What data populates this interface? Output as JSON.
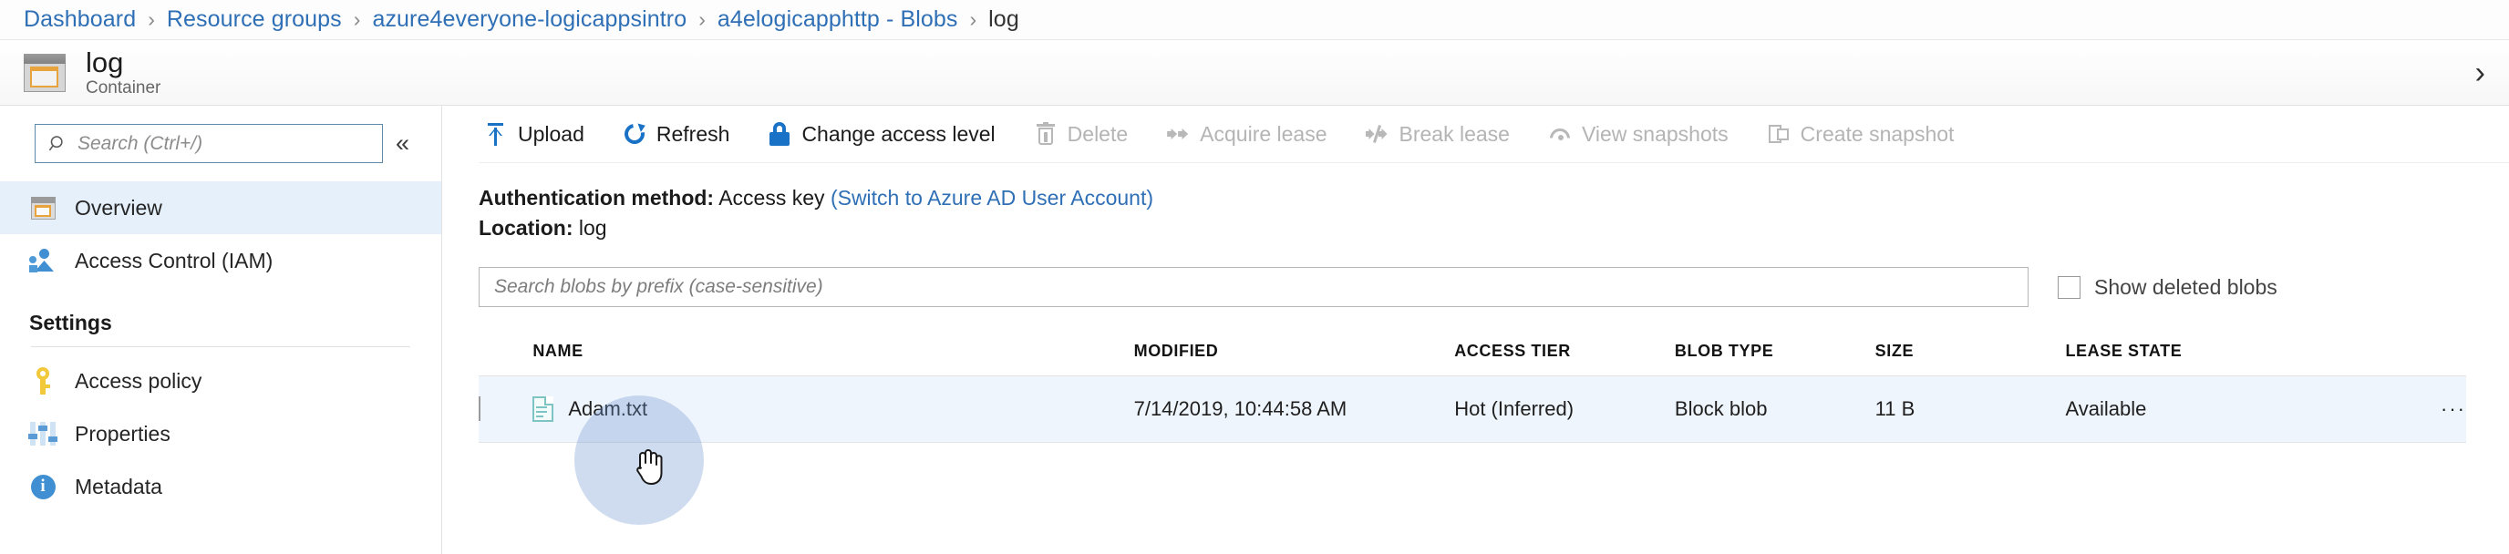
{
  "breadcrumb": {
    "separator": "›",
    "items": [
      {
        "label": "Dashboard",
        "current": false
      },
      {
        "label": "Resource groups",
        "current": false
      },
      {
        "label": "azure4everyone-logicappsintro",
        "current": false
      },
      {
        "label": "a4elogicapphttp - Blobs",
        "current": false
      },
      {
        "label": "log",
        "current": true
      }
    ]
  },
  "header": {
    "title": "log",
    "subtitle": "Container",
    "close_glyph": "›",
    "icon": "container-icon"
  },
  "sidebar": {
    "search": {
      "placeholder": "Search (Ctrl+/)",
      "icon": "search-icon"
    },
    "collapse_glyph": "«",
    "items": [
      {
        "label": "Overview",
        "icon": "container-icon",
        "selected": true
      },
      {
        "label": "Access Control (IAM)",
        "icon": "people-icon",
        "selected": false
      }
    ],
    "settings_section": {
      "title": "Settings",
      "items": [
        {
          "label": "Access policy",
          "icon": "key-icon"
        },
        {
          "label": "Properties",
          "icon": "sliders-icon"
        },
        {
          "label": "Metadata",
          "icon": "info-icon"
        }
      ]
    }
  },
  "toolbar": {
    "buttons": [
      {
        "label": "Upload",
        "icon": "upload-icon",
        "enabled": true
      },
      {
        "label": "Refresh",
        "icon": "refresh-icon",
        "enabled": true
      },
      {
        "label": "Change access level",
        "icon": "lock-icon",
        "enabled": true
      },
      {
        "label": "Delete",
        "icon": "trash-icon",
        "enabled": false
      },
      {
        "label": "Acquire lease",
        "icon": "acquire-lease-icon",
        "enabled": false
      },
      {
        "label": "Break lease",
        "icon": "break-lease-icon",
        "enabled": false
      },
      {
        "label": "View snapshots",
        "icon": "view-snapshots-icon",
        "enabled": false
      },
      {
        "label": "Create snapshot",
        "icon": "create-snapshot-icon",
        "enabled": false
      }
    ]
  },
  "info": {
    "auth_label": "Authentication method:",
    "auth_value": "Access key",
    "auth_switch_link": "(Switch to Azure AD User Account)",
    "location_label": "Location:",
    "location_value": "log"
  },
  "blob_search": {
    "placeholder": "Search blobs by prefix (case-sensitive)",
    "value": ""
  },
  "show_deleted": {
    "label": "Show deleted blobs",
    "checked": false
  },
  "table": {
    "columns": [
      "NAME",
      "MODIFIED",
      "ACCESS TIER",
      "BLOB TYPE",
      "SIZE",
      "LEASE STATE"
    ],
    "rows": [
      {
        "name": "Adam.txt",
        "modified": "7/14/2019, 10:44:58 AM",
        "access_tier": "Hot (Inferred)",
        "blob_type": "Block blob",
        "size": "11 B",
        "lease_state": "Available",
        "menu_glyph": "···",
        "checked": false,
        "hovered": true
      }
    ]
  },
  "colors": {
    "link": "#2f6fb5",
    "accent": "#1a72c6",
    "selected_row": "#e5f0fb",
    "hover_row": "#eff5fc",
    "disabled_text": "#b4b4b4"
  }
}
